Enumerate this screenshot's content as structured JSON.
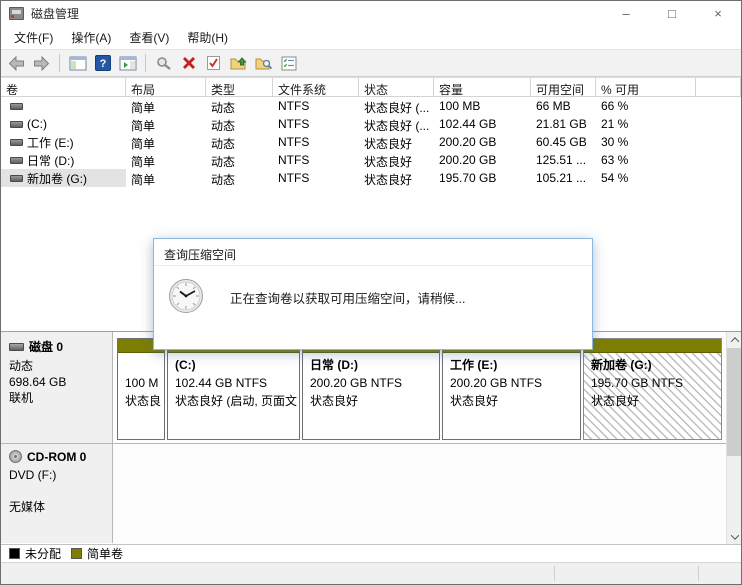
{
  "window": {
    "title": "磁盘管理",
    "controls": {
      "minimize": "–",
      "maximize": "□",
      "close": "×"
    }
  },
  "menu": {
    "items": [
      {
        "label": "文件(F)"
      },
      {
        "label": "操作(A)"
      },
      {
        "label": "查看(V)"
      },
      {
        "label": "帮助(H)"
      }
    ]
  },
  "toolbar": {
    "icons": [
      "back-icon",
      "forward-icon",
      "console-tree-icon",
      "help-icon",
      "action-pane-icon",
      "search-icon",
      "delete-volume-icon",
      "check-document-icon",
      "folder-up-icon",
      "folder-search-icon",
      "properties-list-icon"
    ]
  },
  "volume_table": {
    "columns": [
      "卷",
      "布局",
      "类型",
      "文件系统",
      "状态",
      "容量",
      "可用空间",
      "% 可用"
    ],
    "rows": [
      {
        "name": "",
        "layout": "简单",
        "type": "动态",
        "fs": "NTFS",
        "status": "状态良好 (...",
        "capacity": "100 MB",
        "free": "66 MB",
        "pct": "66 %"
      },
      {
        "name": "(C:)",
        "layout": "简单",
        "type": "动态",
        "fs": "NTFS",
        "status": "状态良好 (...",
        "capacity": "102.44 GB",
        "free": "21.81 GB",
        "pct": "21 %"
      },
      {
        "name": "工作 (E:)",
        "layout": "简单",
        "type": "动态",
        "fs": "NTFS",
        "status": "状态良好",
        "capacity": "200.20 GB",
        "free": "60.45 GB",
        "pct": "30 %"
      },
      {
        "name": "日常 (D:)",
        "layout": "简单",
        "type": "动态",
        "fs": "NTFS",
        "status": "状态良好",
        "capacity": "200.20 GB",
        "free": "125.51 ...",
        "pct": "63 %"
      },
      {
        "name": "新加卷 (G:)",
        "layout": "简单",
        "type": "动态",
        "fs": "NTFS",
        "status": "状态良好",
        "capacity": "195.70 GB",
        "free": "105.21 ...",
        "pct": "54 %"
      }
    ]
  },
  "dialog": {
    "title": "查询压缩空间",
    "message": "正在查询卷以获取可用压缩空间，请稍候...",
    "icon": "clock-icon"
  },
  "disk0": {
    "name": "磁盘 0",
    "type": "动态",
    "size": "698.64 GB",
    "status": "联机",
    "partitions": [
      {
        "name": "",
        "line1": "100 M",
        "line2": "状态良",
        "selected": false
      },
      {
        "name": "(C:)",
        "line1": "102.44 GB NTFS",
        "line2": "状态良好 (启动, 页面文",
        "selected": false
      },
      {
        "name": "日常 (D:)",
        "line1": "200.20 GB NTFS",
        "line2": "状态良好",
        "selected": false
      },
      {
        "name": "工作 (E:)",
        "line1": "200.20 GB NTFS",
        "line2": "状态良好",
        "selected": false
      },
      {
        "name": "新加卷 (G:)",
        "line1": "195.70 GB NTFS",
        "line2": "状态良好",
        "selected": true
      }
    ]
  },
  "cdrom": {
    "name": "CD-ROM 0",
    "drive": "DVD (F:)",
    "media": "无媒体"
  },
  "legend": {
    "items": [
      {
        "label": "未分配",
        "color": "#000000"
      },
      {
        "label": "简单卷",
        "color": "#7e7e00"
      }
    ]
  },
  "colors": {
    "simple_volume": "#7e7e00",
    "dialog_border": "#8cb8de",
    "selected_row_bg": "#e3e3e3"
  }
}
